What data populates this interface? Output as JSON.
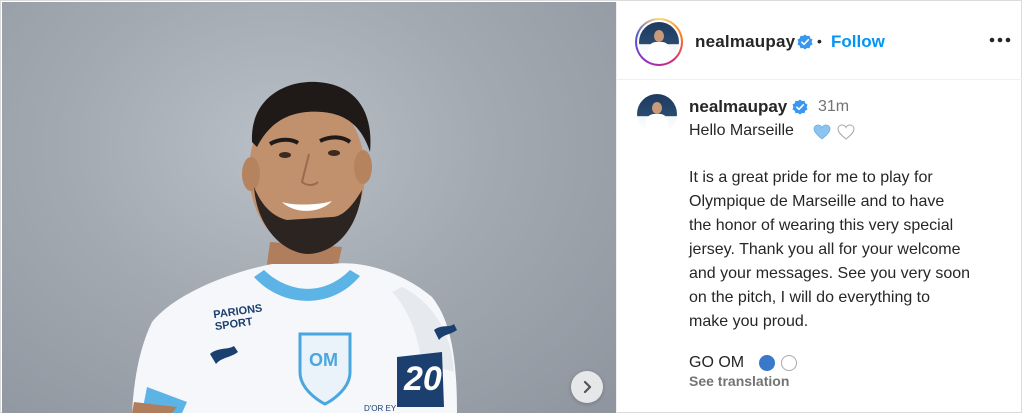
{
  "header": {
    "username": "nealmaupay",
    "separator": "•",
    "follow_label": "Follow",
    "icons": {
      "verified": "verified-badge-icon",
      "more": "more-options-icon"
    }
  },
  "media": {
    "icons": {
      "next": "chevron-right-icon"
    },
    "jersey_text": {
      "sponsor": "PARIONS SPORT",
      "crest": "OM",
      "number": "20",
      "hem_text": "D'OR EY"
    },
    "colors": {
      "jersey_white": "#f5f7fa",
      "jersey_trim": "#5bb3e6",
      "crest_blue": "#4aa6df"
    }
  },
  "caption": {
    "username": "nealmaupay",
    "time": "31m",
    "greeting": "Hello Marseille",
    "greeting_emoji": [
      "blue-heart",
      "white-heart"
    ],
    "body_lines": [
      "It is a great pride for me to play for",
      "Olympique de Marseille and to have",
      "the honor of wearing this very special",
      "jersey. Thank you all for your welcome",
      "and your messages. See you very soon",
      "on the pitch, I will do everything to",
      "make you proud."
    ],
    "signoff": "GO OM",
    "signoff_emoji": [
      "blue-circle",
      "white-circle"
    ],
    "see_translation": "See translation"
  },
  "colors": {
    "link": "#0095f6",
    "verified": "#3897f0",
    "muted": "#737373",
    "text": "#262626"
  }
}
